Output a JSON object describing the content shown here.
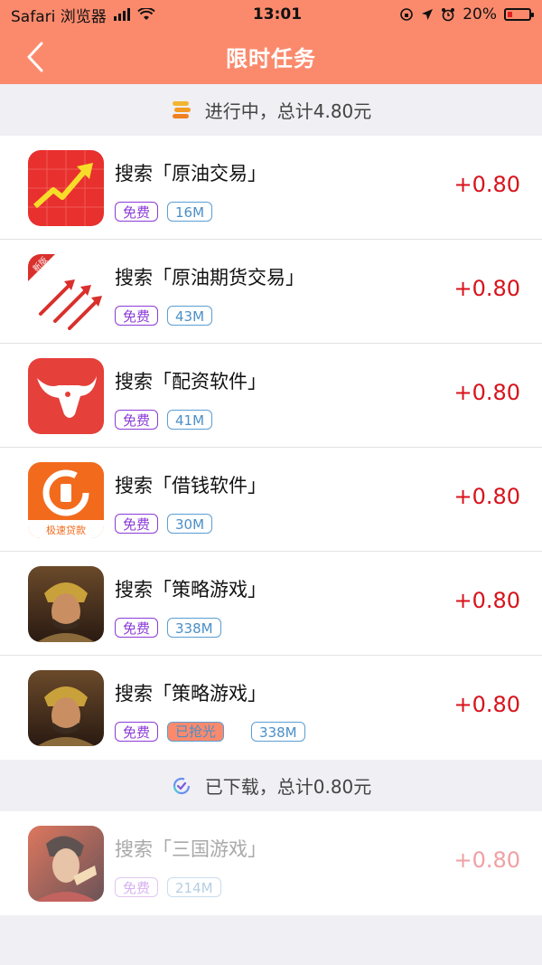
{
  "status_bar": {
    "carrier": "Safari 浏览器",
    "time": "13:01",
    "battery": "20%",
    "battery_level": 0.2
  },
  "navbar": {
    "back_icon": "chevron-left-icon",
    "title": "限时任务"
  },
  "sections": {
    "in_progress": {
      "label": "进行中，总计4.80元",
      "icon": "coins-stack-icon"
    },
    "downloaded": {
      "label": "已下载，总计0.80元",
      "icon": "refresh-check-icon"
    }
  },
  "tasks": [
    {
      "name": "搜索「原油交易」",
      "free": "免费",
      "size": "16M",
      "reward": "+0.80",
      "icon": "stock-chart-icon"
    },
    {
      "name": "搜索「原油期货交易」",
      "free": "免费",
      "size": "43M",
      "reward": "+0.80",
      "icon": "rockets-icon",
      "badge": "新版"
    },
    {
      "name": "搜索「配资软件」",
      "free": "免费",
      "size": "41M",
      "reward": "+0.80",
      "icon": "bull-icon"
    },
    {
      "name": "搜索「借钱软件」",
      "free": "免费",
      "size": "30M",
      "reward": "+0.80",
      "icon": "loan-app-icon",
      "caption": "极速贷款"
    },
    {
      "name": "搜索「策略游戏」",
      "free": "免费",
      "size": "338M",
      "reward": "+0.80",
      "icon": "warrior-game-icon"
    },
    {
      "name": "搜索「策略游戏」",
      "free": "免费",
      "status": "已抢光",
      "size": "338M",
      "reward": "+0.80",
      "icon": "warrior-game-icon"
    }
  ],
  "downloaded_tasks": [
    {
      "name": "搜索「三国游戏」",
      "free": "免费",
      "size": "214M",
      "reward": "+0.80",
      "icon": "three-kingdoms-game-icon"
    }
  ],
  "colors": {
    "header": "#fb8a6d",
    "reward": "#d8121b",
    "free_tag": "#8b3bd6",
    "size_tag": "#5b9ed3"
  }
}
